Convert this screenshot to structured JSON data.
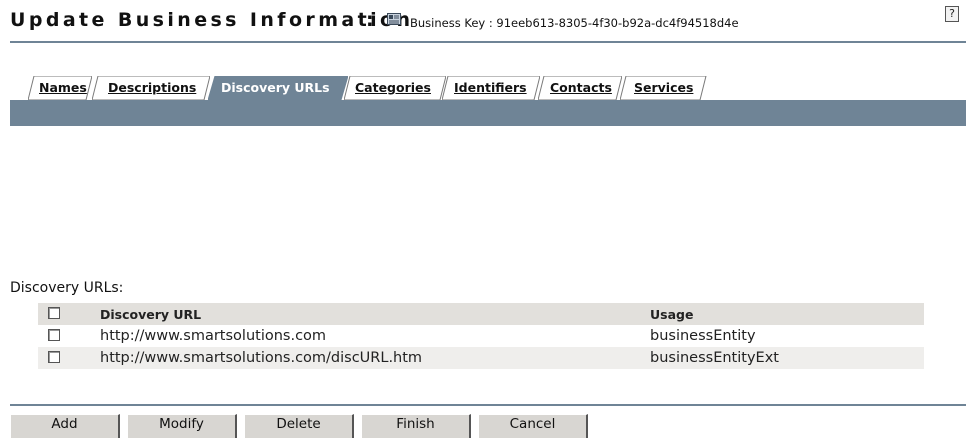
{
  "header": {
    "title": "Update Business Information",
    "separator": ":",
    "business_key": "Business Key : 91eeb613-8305-4f30-b92a-dc4f94518d4e",
    "help": "?"
  },
  "tabs": [
    {
      "label": "Names",
      "active": false
    },
    {
      "label": "Descriptions",
      "active": false
    },
    {
      "label": "Discovery URLs",
      "active": true
    },
    {
      "label": "Categories",
      "active": false
    },
    {
      "label": "Identifiers",
      "active": false
    },
    {
      "label": "Contacts",
      "active": false
    },
    {
      "label": "Services",
      "active": false
    }
  ],
  "section": {
    "label": "Discovery URLs:"
  },
  "grid": {
    "columns": {
      "url": "Discovery URL",
      "usage": "Usage"
    },
    "rows": [
      {
        "url": "http://www.smartsolutions.com",
        "usage": "businessEntity",
        "checked": false
      },
      {
        "url": "http://www.smartsolutions.com/discURL.htm",
        "usage": "businessEntityExt",
        "checked": false
      }
    ]
  },
  "buttons": {
    "add": "Add",
    "modify": "Modify",
    "delete": "Delete",
    "finish": "Finish",
    "cancel": "Cancel"
  },
  "colors": {
    "accent_bar": "#6f8496",
    "active_tab": "#6f8496",
    "inactive_tab": "#ffffff",
    "header_row": "#e2e0dc",
    "button_face": "#d8d6d2"
  },
  "icons": {
    "business_key": "business-card-icon",
    "help": "help-icon"
  }
}
